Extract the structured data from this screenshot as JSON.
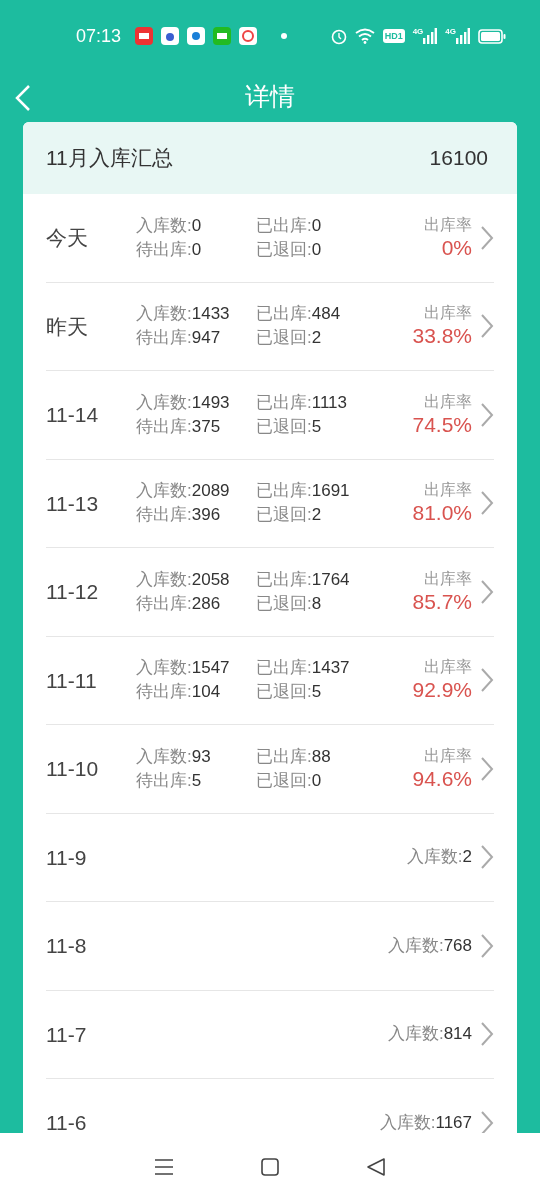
{
  "status_bar": {
    "time": "07:13",
    "network_badge": "HD1",
    "signal_labels": [
      "4G",
      "4G"
    ]
  },
  "header": {
    "title": "详情"
  },
  "summary": {
    "title": "11月入库汇总",
    "total": "16100"
  },
  "rows": [
    {
      "kind": "detail",
      "date": "今天",
      "stats": [
        {
          "label": "入库数:",
          "value": "0"
        },
        {
          "label": "已出库:",
          "value": "0"
        },
        {
          "label": "待出库:",
          "value": "0"
        },
        {
          "label": "已退回:",
          "value": "0"
        }
      ],
      "rate_label": "出库率",
      "rate": "0%"
    },
    {
      "kind": "detail",
      "date": "昨天",
      "stats": [
        {
          "label": "入库数:",
          "value": "1433"
        },
        {
          "label": "已出库:",
          "value": "484"
        },
        {
          "label": "待出库:",
          "value": "947"
        },
        {
          "label": "已退回:",
          "value": "2"
        }
      ],
      "rate_label": "出库率",
      "rate": "33.8%"
    },
    {
      "kind": "detail",
      "date": "11-14",
      "stats": [
        {
          "label": "入库数:",
          "value": "1493"
        },
        {
          "label": "已出库:",
          "value": "1113"
        },
        {
          "label": "待出库:",
          "value": "375"
        },
        {
          "label": "已退回:",
          "value": "5"
        }
      ],
      "rate_label": "出库率",
      "rate": "74.5%"
    },
    {
      "kind": "detail",
      "date": "11-13",
      "stats": [
        {
          "label": "入库数:",
          "value": "2089"
        },
        {
          "label": "已出库:",
          "value": "1691"
        },
        {
          "label": "待出库:",
          "value": "396"
        },
        {
          "label": "已退回:",
          "value": "2"
        }
      ],
      "rate_label": "出库率",
      "rate": "81.0%"
    },
    {
      "kind": "detail",
      "date": "11-12",
      "stats": [
        {
          "label": "入库数:",
          "value": "2058"
        },
        {
          "label": "已出库:",
          "value": "1764"
        },
        {
          "label": "待出库:",
          "value": "286"
        },
        {
          "label": "已退回:",
          "value": "8"
        }
      ],
      "rate_label": "出库率",
      "rate": "85.7%"
    },
    {
      "kind": "detail",
      "date": "11-11",
      "stats": [
        {
          "label": "入库数:",
          "value": "1547"
        },
        {
          "label": "已出库:",
          "value": "1437"
        },
        {
          "label": "待出库:",
          "value": "104"
        },
        {
          "label": "已退回:",
          "value": "5"
        }
      ],
      "rate_label": "出库率",
      "rate": "92.9%"
    },
    {
      "kind": "detail",
      "date": "11-10",
      "stats": [
        {
          "label": "入库数:",
          "value": "93"
        },
        {
          "label": "已出库:",
          "value": "88"
        },
        {
          "label": "待出库:",
          "value": "5"
        },
        {
          "label": "已退回:",
          "value": "0"
        }
      ],
      "rate_label": "出库率",
      "rate": "94.6%"
    },
    {
      "kind": "simple",
      "date": "11-9",
      "stat": {
        "label": "入库数:",
        "value": "2"
      }
    },
    {
      "kind": "simple",
      "date": "11-8",
      "stat": {
        "label": "入库数:",
        "value": "768"
      }
    },
    {
      "kind": "simple",
      "date": "11-7",
      "stat": {
        "label": "入库数:",
        "value": "814"
      }
    },
    {
      "kind": "simple",
      "date": "11-6",
      "stat": {
        "label": "入库数:",
        "value": "1167"
      }
    }
  ]
}
